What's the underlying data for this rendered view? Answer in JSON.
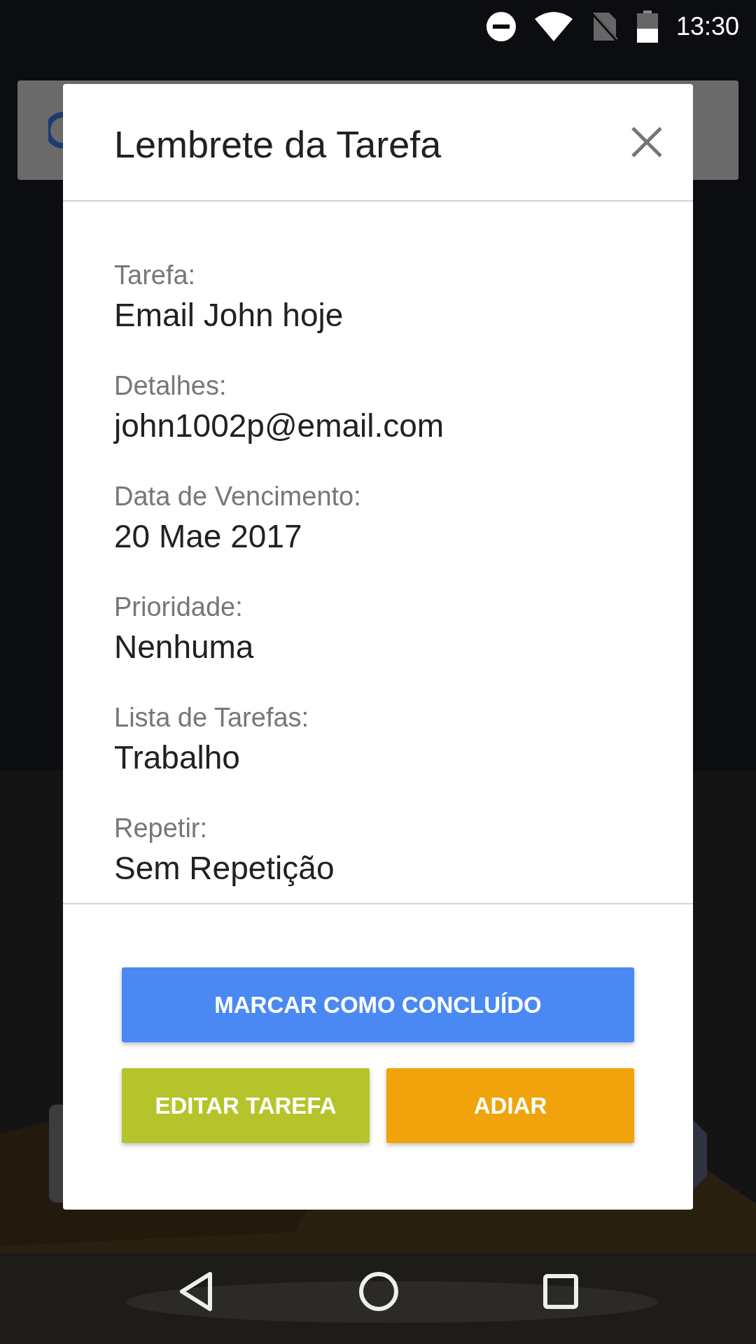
{
  "status_bar": {
    "time": "13:30"
  },
  "dialog": {
    "title": "Lembrete da Tarefa",
    "fields": [
      {
        "label": "Tarefa:",
        "value": "Email John hoje"
      },
      {
        "label": "Detalhes:",
        "value": "john1002p@email.com"
      },
      {
        "label": "Data de Vencimento:",
        "value": "20 Mae 2017"
      },
      {
        "label": "Prioridade:",
        "value": "Nenhuma"
      },
      {
        "label": "Lista de Tarefas:",
        "value": "Trabalho"
      },
      {
        "label": "Repetir:",
        "value": "Sem Repetição"
      }
    ],
    "buttons": [
      {
        "label": "MARCAR COMO CONCLUÍDO",
        "kind": "complete"
      },
      {
        "label": "EDITAR TAREFA",
        "kind": "edit"
      },
      {
        "label": "ADIAR",
        "kind": "postpone"
      }
    ]
  }
}
